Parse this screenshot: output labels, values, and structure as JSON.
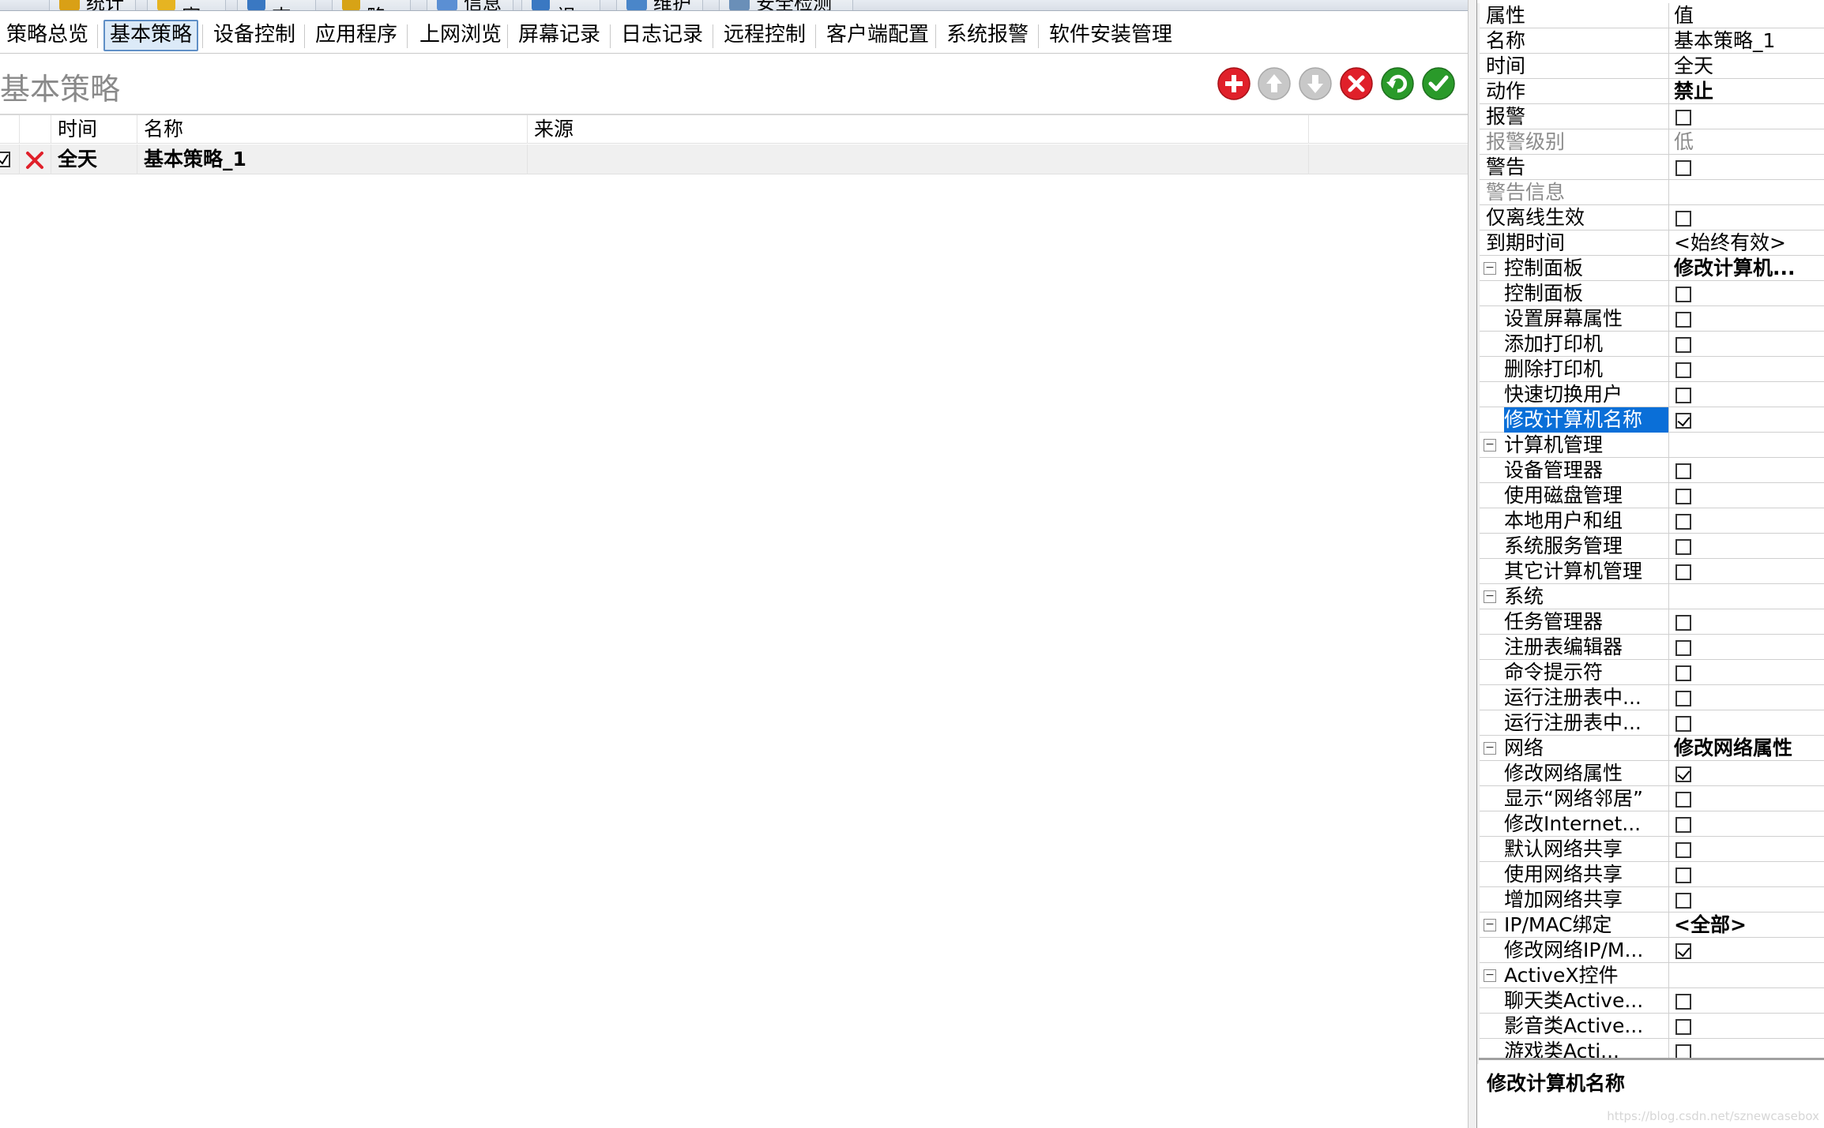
{
  "main_tabs": [
    {
      "label": "统计",
      "icon": "chart-icon"
    },
    {
      "label": "加密",
      "icon": "folder-lock-icon"
    },
    {
      "label": "日志",
      "icon": "log-icon"
    },
    {
      "label": "策略",
      "icon": "gear-icon"
    },
    {
      "label": "信息",
      "icon": "users-icon"
    },
    {
      "label": "监视",
      "icon": "monitor-icon"
    },
    {
      "label": "维护",
      "icon": "wrench-icon"
    },
    {
      "label": "安全检测",
      "icon": "security-check-icon"
    }
  ],
  "sub_tabs": [
    {
      "label": "策略总览",
      "active": false
    },
    {
      "label": "基本策略",
      "active": true
    },
    {
      "label": "设备控制",
      "active": false
    },
    {
      "label": "应用程序",
      "active": false
    },
    {
      "label": "上网浏览",
      "active": false
    },
    {
      "label": "屏幕记录",
      "active": false
    },
    {
      "label": "日志记录",
      "active": false
    },
    {
      "label": "远程控制",
      "active": false
    },
    {
      "label": "客户端配置",
      "active": false
    },
    {
      "label": "系统报警",
      "active": false
    },
    {
      "label": "软件安装管理",
      "active": false
    }
  ],
  "page": {
    "title": "基本策略"
  },
  "toolbar": {
    "add": "plus-icon",
    "up": "arrow-up-icon",
    "down": "arrow-down-icon",
    "delete": "delete-icon",
    "undo": "undo-icon",
    "apply": "check-icon"
  },
  "colors": {
    "accent": "#0a6fd8",
    "red": "#e0202a",
    "green": "#2a9a2a",
    "grey_button": "#c8c8c8"
  },
  "grid": {
    "columns": [
      "时间",
      "名称",
      "来源"
    ],
    "rows": [
      {
        "time": "全天",
        "name": "基本策略_1",
        "source": "",
        "checked": true,
        "action": "禁止"
      }
    ]
  },
  "properties": {
    "header": {
      "name": "属性",
      "value": "值"
    },
    "rows": [
      {
        "name": "名称",
        "value": "基本策略_1",
        "type": "text"
      },
      {
        "name": "时间",
        "value": "全天",
        "type": "text"
      },
      {
        "name": "动作",
        "value": "禁止",
        "type": "bold"
      },
      {
        "name": "报警",
        "type": "checkbox",
        "checked": false
      },
      {
        "name": "报警级别",
        "value": "低",
        "type": "text",
        "grey": true
      },
      {
        "name": "警告",
        "type": "checkbox",
        "checked": false
      },
      {
        "name": "警告信息",
        "value": "",
        "type": "text",
        "grey": true
      },
      {
        "name": "仅离线生效",
        "type": "checkbox",
        "checked": false
      },
      {
        "name": "到期时间",
        "value": "<始终有效>",
        "type": "text"
      },
      {
        "name": "控制面板",
        "value": "修改计算机...",
        "type": "group"
      },
      {
        "name": "控制面板",
        "type": "checkbox",
        "checked": false,
        "child": true
      },
      {
        "name": "设置屏幕属性",
        "type": "checkbox",
        "checked": false,
        "child": true
      },
      {
        "name": "添加打印机",
        "type": "checkbox",
        "checked": false,
        "child": true
      },
      {
        "name": "删除打印机",
        "type": "checkbox",
        "checked": false,
        "child": true
      },
      {
        "name": "快速切换用户",
        "type": "checkbox",
        "checked": false,
        "child": true
      },
      {
        "name": "修改计算机名称",
        "type": "checkbox",
        "checked": true,
        "child": true,
        "selected": true
      },
      {
        "name": "计算机管理",
        "value": "",
        "type": "group"
      },
      {
        "name": "设备管理器",
        "type": "checkbox",
        "checked": false,
        "child": true
      },
      {
        "name": "使用磁盘管理",
        "type": "checkbox",
        "checked": false,
        "child": true
      },
      {
        "name": "本地用户和组",
        "type": "checkbox",
        "checked": false,
        "child": true
      },
      {
        "name": "系统服务管理",
        "type": "checkbox",
        "checked": false,
        "child": true
      },
      {
        "name": "其它计算机管理",
        "type": "checkbox",
        "checked": false,
        "child": true
      },
      {
        "name": "系统",
        "value": "",
        "type": "group"
      },
      {
        "name": "任务管理器",
        "type": "checkbox",
        "checked": false,
        "child": true
      },
      {
        "name": "注册表编辑器",
        "type": "checkbox",
        "checked": false,
        "child": true
      },
      {
        "name": "命令提示符",
        "type": "checkbox",
        "checked": false,
        "child": true
      },
      {
        "name": "运行注册表中...",
        "type": "checkbox",
        "checked": false,
        "child": true
      },
      {
        "name": "运行注册表中...",
        "type": "checkbox",
        "checked": false,
        "child": true
      },
      {
        "name": "网络",
        "value": "修改网络属性",
        "type": "group"
      },
      {
        "name": "修改网络属性",
        "type": "checkbox",
        "checked": true,
        "child": true
      },
      {
        "name": "显示“网络邻居”",
        "type": "checkbox",
        "checked": false,
        "child": true
      },
      {
        "name": "修改Internet...",
        "type": "checkbox",
        "checked": false,
        "child": true
      },
      {
        "name": "默认网络共享",
        "type": "checkbox",
        "checked": false,
        "child": true
      },
      {
        "name": "使用网络共享",
        "type": "checkbox",
        "checked": false,
        "child": true
      },
      {
        "name": "增加网络共享",
        "type": "checkbox",
        "checked": false,
        "child": true
      },
      {
        "name": "IP/MAC绑定",
        "value": "<全部>",
        "type": "group"
      },
      {
        "name": "修改网络IP/M...",
        "type": "checkbox",
        "checked": true,
        "child": true
      },
      {
        "name": "ActiveX控件",
        "value": "",
        "type": "group"
      },
      {
        "name": "聊天类Active...",
        "type": "checkbox",
        "checked": false,
        "child": true
      },
      {
        "name": "影音类Active...",
        "type": "checkbox",
        "checked": false,
        "child": true
      },
      {
        "name": "游戏类Acti...",
        "type": "checkbox",
        "checked": false,
        "child": true
      }
    ],
    "description": "修改计算机名称"
  },
  "watermark": "https://blog.csdn.net/sznewcasebox"
}
